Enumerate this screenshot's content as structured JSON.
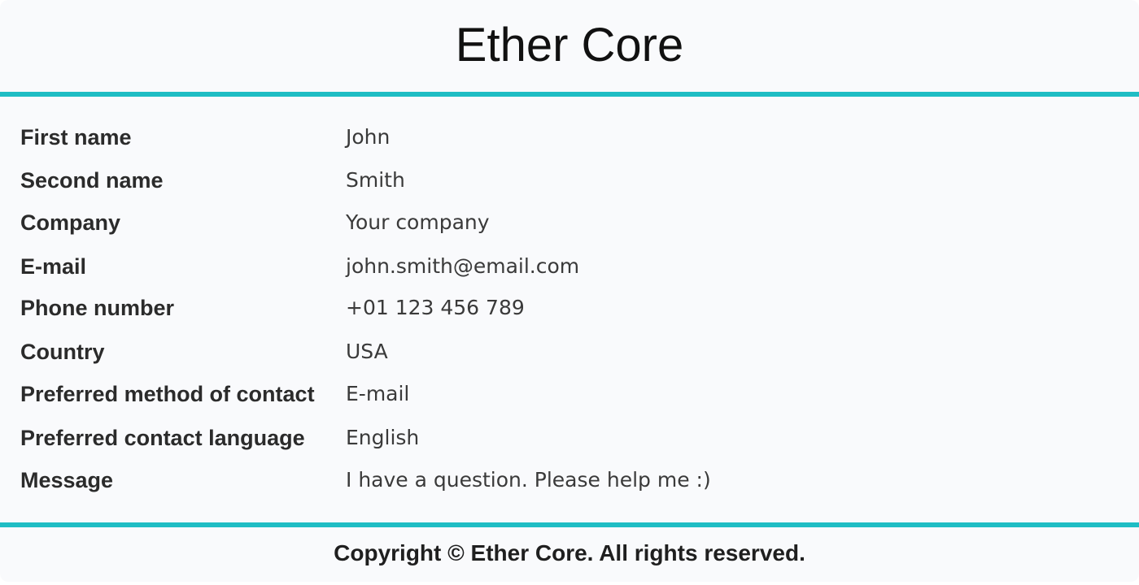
{
  "header": {
    "title": "Ether Core"
  },
  "details": [
    {
      "label": "First name",
      "value": "John"
    },
    {
      "label": "Second name",
      "value": "Smith"
    },
    {
      "label": "Company",
      "value": "Your company"
    },
    {
      "label": "E-mail",
      "value": "john.smith@email.com"
    },
    {
      "label": "Phone number",
      "value": "+01 123 456 789"
    },
    {
      "label": "Country",
      "value": "USA"
    },
    {
      "label": "Preferred method of contact",
      "value": "E-mail"
    },
    {
      "label": "Preferred contact language",
      "value": "English"
    },
    {
      "label": "Message",
      "value": "I have a question. Please help me :)"
    }
  ],
  "footer": {
    "copyright": "Copyright © Ether Core. All rights reserved."
  },
  "colors": {
    "accent": "#1fbdc4",
    "background": "#f9fafc"
  }
}
